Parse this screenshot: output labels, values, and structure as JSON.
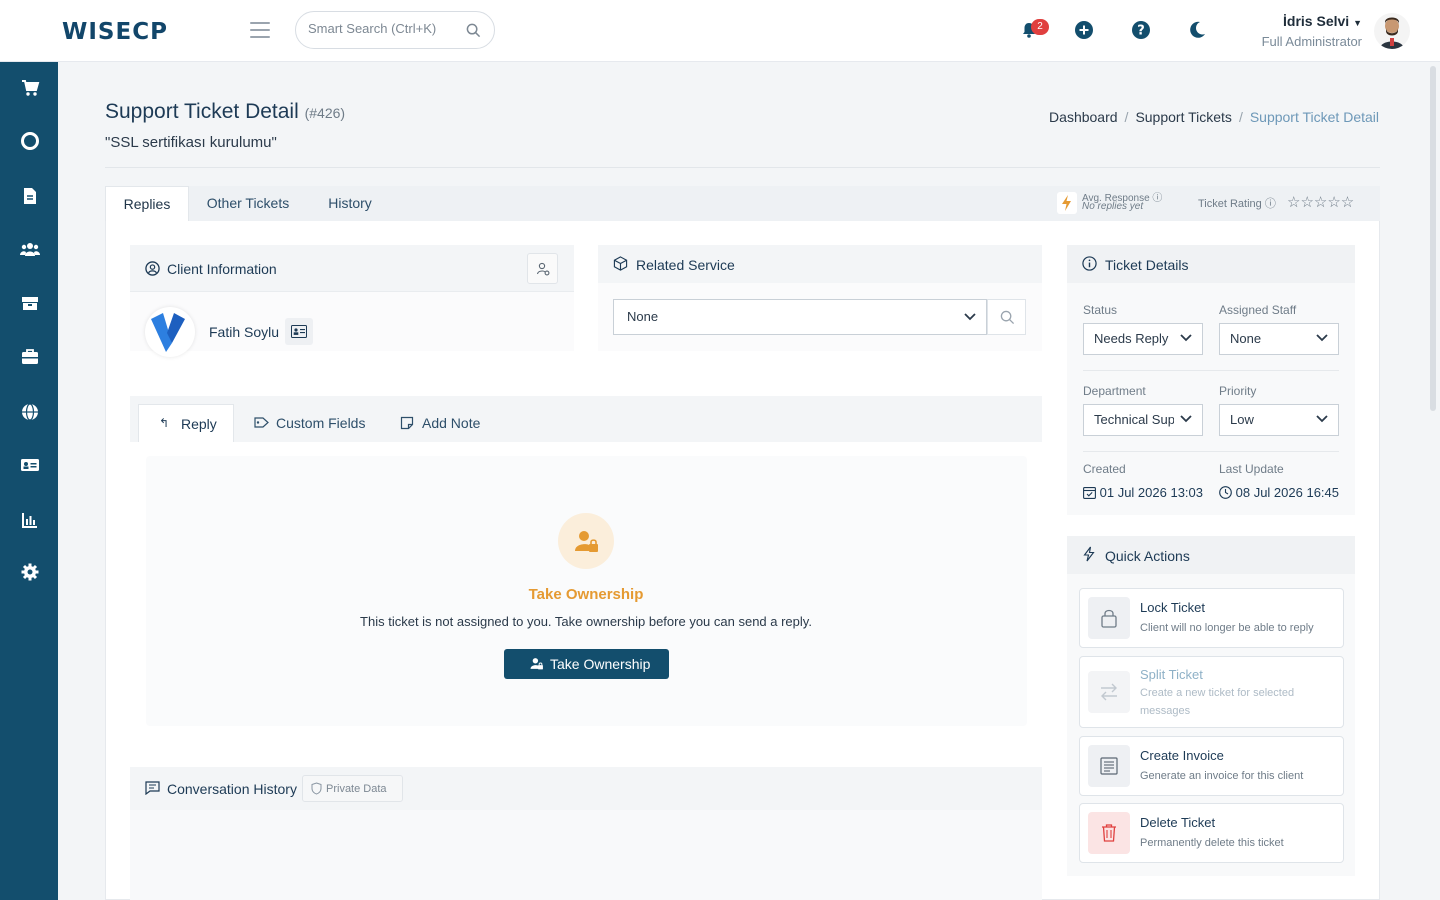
{
  "header": {
    "logo": "WISECP",
    "search_placeholder": "Smart Search (Ctrl+K)",
    "notifications_count": "2",
    "user_name": "İdris Selvi",
    "user_role": "Full Administrator"
  },
  "sidebar": {
    "icons": [
      "cart-icon",
      "lifebuoy-icon",
      "document-icon",
      "users-icon",
      "box-icon",
      "toolbox-icon",
      "globe-icon",
      "id-card-icon",
      "bar-chart-icon",
      "gear-icon"
    ]
  },
  "page": {
    "title": "Support Ticket Detail",
    "ticket_number": "(#426)",
    "subject": "\"SSL sertifikası kurulumu\"",
    "breadcrumb": [
      "Dashboard",
      "Support Tickets",
      "Support Ticket Detail"
    ]
  },
  "tabs": [
    "Replies",
    "Other Tickets",
    "History"
  ],
  "metrics": {
    "avg_response_label": "Avg. Response",
    "avg_response_value": "No replies yet",
    "ticket_rating_label": "Ticket Rating",
    "stars": "☆☆☆☆☆"
  },
  "client_info": {
    "title": "Client Information",
    "client_name": "Fatih Soylu"
  },
  "related_service": {
    "title": "Related Service",
    "selected": "None"
  },
  "reply_tabs": [
    "Reply",
    "Custom Fields",
    "Add Note"
  ],
  "take_ownership": {
    "title": "Take Ownership",
    "message": "This ticket is not assigned to you. Take ownership before you can send a reply.",
    "button": "Take Ownership"
  },
  "conversation": {
    "title": "Conversation History",
    "private_badge": "Private Data"
  },
  "ticket_details": {
    "title": "Ticket Details",
    "status_label": "Status",
    "status_value": "Needs Reply",
    "staff_label": "Assigned Staff",
    "staff_value": "None",
    "department_label": "Department",
    "department_value": "Technical Sup",
    "priority_label": "Priority",
    "priority_value": "Low",
    "created_label": "Created",
    "created_value": "01 Jul 2026 13:03",
    "updated_label": "Last Update",
    "updated_value": "08 Jul 2026 16:45"
  },
  "quick_actions": {
    "title": "Quick Actions",
    "items": [
      {
        "title": "Lock Ticket",
        "desc": "Client will no longer be able to reply"
      },
      {
        "title": "Split Ticket",
        "desc": "Create a new ticket for selected messages"
      },
      {
        "title": "Create Invoice",
        "desc": "Generate an invoice for this client"
      },
      {
        "title": "Delete Ticket",
        "desc": "Permanently delete this ticket"
      }
    ]
  },
  "colors": {
    "primary": "#134e6d",
    "accent_orange": "#e59a32",
    "danger": "#e0403f"
  }
}
